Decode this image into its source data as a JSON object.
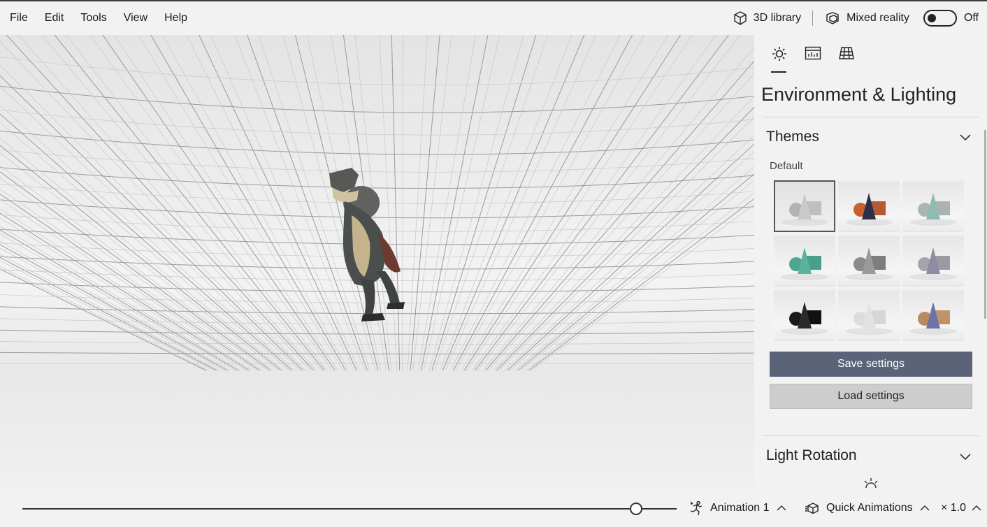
{
  "menu": {
    "items": [
      {
        "label": "File"
      },
      {
        "label": "Edit"
      },
      {
        "label": "Tools"
      },
      {
        "label": "View"
      },
      {
        "label": "Help"
      }
    ],
    "library_label": "3D library",
    "mixed_reality_label": "Mixed reality",
    "toggle_state": "Off"
  },
  "panel": {
    "tabs": [
      {
        "icon": "sun-icon",
        "active": true
      },
      {
        "icon": "stats-icon",
        "active": false
      },
      {
        "icon": "grid-icon",
        "active": false
      }
    ],
    "title": "Environment & Lighting",
    "themes": {
      "header": "Themes",
      "sub_label": "Default",
      "tiles": [
        {
          "colors": [
            "#b3b3b3",
            "#c9c9c9",
            "#bfbfbf"
          ],
          "selected": true
        },
        {
          "colors": [
            "#c8612f",
            "#2b3147",
            "#b35a35"
          ],
          "selected": false
        },
        {
          "colors": [
            "#a9b7b2",
            "#8fbcb0",
            "#a9b3b1"
          ],
          "selected": false
        },
        {
          "colors": [
            "#4fa58e",
            "#59b39b",
            "#48a08a"
          ],
          "selected": false
        },
        {
          "colors": [
            "#8a8a8a",
            "#9a9a9a",
            "#7d7d7d"
          ],
          "selected": false
        },
        {
          "colors": [
            "#a5a3ad",
            "#8e8ca3",
            "#9b9aa3"
          ],
          "selected": false
        },
        {
          "colors": [
            "#1a1a1a",
            "#2a2a2a",
            "#111111"
          ],
          "selected": false
        },
        {
          "colors": [
            "#dcdcdc",
            "#e2e2e2",
            "#d6d6d6"
          ],
          "selected": false
        },
        {
          "colors": [
            "#b78a5f",
            "#6f72a8",
            "#c09468"
          ],
          "selected": false
        }
      ],
      "save_label": "Save settings",
      "load_label": "Load settings"
    },
    "light_rotation": {
      "header": "Light Rotation"
    }
  },
  "bottom": {
    "timeline_progress": 0.94,
    "animation_label": "Animation 1",
    "quick_animations_label": "Quick Animations",
    "speed_label": "× 1.0"
  },
  "colors": {
    "save_button": "#5b6378",
    "background": "#f2f2f2"
  }
}
